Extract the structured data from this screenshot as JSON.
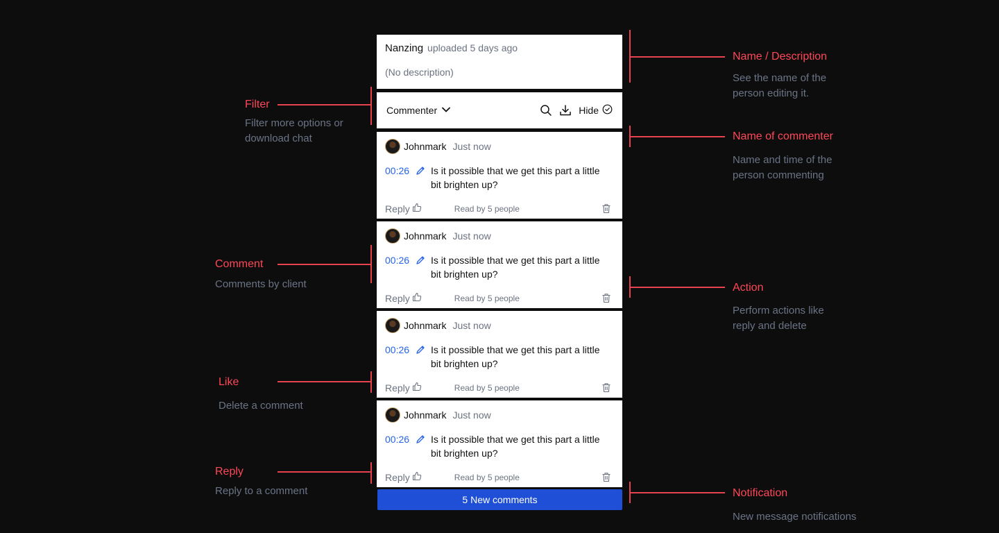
{
  "header": {
    "uploader_name": "Nanzing",
    "uploaded_text": "uploaded 5 days ago",
    "description": "(No description)"
  },
  "filter": {
    "label": "Commenter",
    "hide_label": "Hide"
  },
  "comments": [
    {
      "author": "Johnmark",
      "time": "Just now",
      "timestamp": "00:26",
      "text": "Is it possible that we get this part a little bit brighten up?",
      "reply_label": "Reply",
      "read_by": "Read by 5 people"
    },
    {
      "author": "Johnmark",
      "time": "Just now",
      "timestamp": "00:26",
      "text": "Is it possible that we get this part a little bit brighten up?",
      "reply_label": "Reply",
      "read_by": "Read by 5 people"
    },
    {
      "author": "Johnmark",
      "time": "Just now",
      "timestamp": "00:26",
      "text": "Is it possible that we get this part a little bit brighten up?",
      "reply_label": "Reply",
      "read_by": "Read by 5 people"
    },
    {
      "author": "Johnmark",
      "time": "Just now",
      "timestamp": "00:26",
      "text": "Is it possible that we get this part a little bit brighten up?",
      "reply_label": "Reply",
      "read_by": "Read by 5 people"
    }
  ],
  "notification": {
    "label": "5 New comments"
  },
  "annotations": {
    "filter": {
      "title": "Filter",
      "subtitle": "Filter more options or download chat"
    },
    "comment": {
      "title": "Comment",
      "subtitle": "Comments by client"
    },
    "like": {
      "title": "Like",
      "subtitle": "Delete a comment"
    },
    "reply": {
      "title": "Reply",
      "subtitle": "Reply to a comment"
    },
    "name_description": {
      "title": "Name / Description",
      "subtitle": "See the name of the person editing it."
    },
    "name_of_commenter": {
      "title": "Name of commenter",
      "subtitle": "Name and time of the person commenting"
    },
    "action": {
      "title": "Action",
      "subtitle": "Perform actions like reply and delete"
    },
    "notification": {
      "title": "Notification",
      "subtitle": "New message notifications"
    }
  },
  "colors": {
    "background": "#0d0d0d",
    "accent_red": "#ff4757",
    "link_blue": "#2563eb",
    "notification_blue": "#1e4fd6"
  },
  "icons": [
    "chevron-down-icon",
    "search-icon",
    "download-icon",
    "check-circle-icon",
    "pen-icon",
    "thumbs-up-icon",
    "trash-icon",
    "avatar"
  ]
}
